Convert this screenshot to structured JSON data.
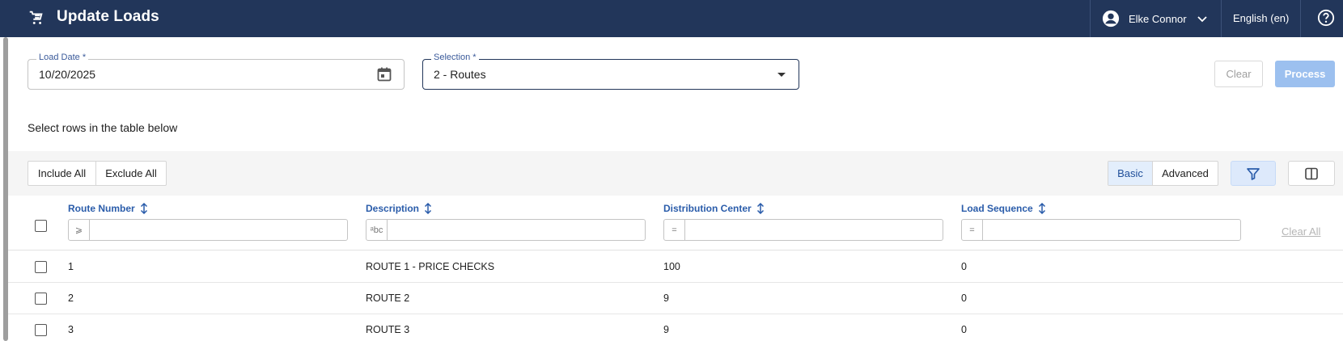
{
  "header": {
    "title": "Update Loads",
    "user_name": "Elke Connor",
    "language": "English (en)"
  },
  "form": {
    "load_date": {
      "label": "Load Date *",
      "value": "10/20/2025"
    },
    "selection": {
      "label": "Selection *",
      "value": "2 - Routes"
    },
    "clear_label": "Clear",
    "process_label": "Process"
  },
  "hint": "Select rows in the table below",
  "toolbar": {
    "include_all": "Include All",
    "exclude_all": "Exclude All",
    "basic": "Basic",
    "advanced": "Advanced"
  },
  "table": {
    "columns": [
      {
        "title": "Route Number",
        "filter_op": "⩾"
      },
      {
        "title": "Description",
        "filter_op": "ᵃbc"
      },
      {
        "title": "Distribution Center",
        "filter_op": "="
      },
      {
        "title": "Load Sequence",
        "filter_op": "="
      }
    ],
    "clear_all": "Clear All",
    "rows": [
      [
        "1",
        "ROUTE 1 - PRICE CHECKS",
        "100",
        "0"
      ],
      [
        "2",
        "ROUTE 2",
        "9",
        "0"
      ],
      [
        "3",
        "ROUTE 3",
        "9",
        "0"
      ]
    ]
  },
  "colors": {
    "header_bg": "#22365a",
    "accent": "#2a5caa",
    "process_disabled": "#9cc0ef"
  }
}
